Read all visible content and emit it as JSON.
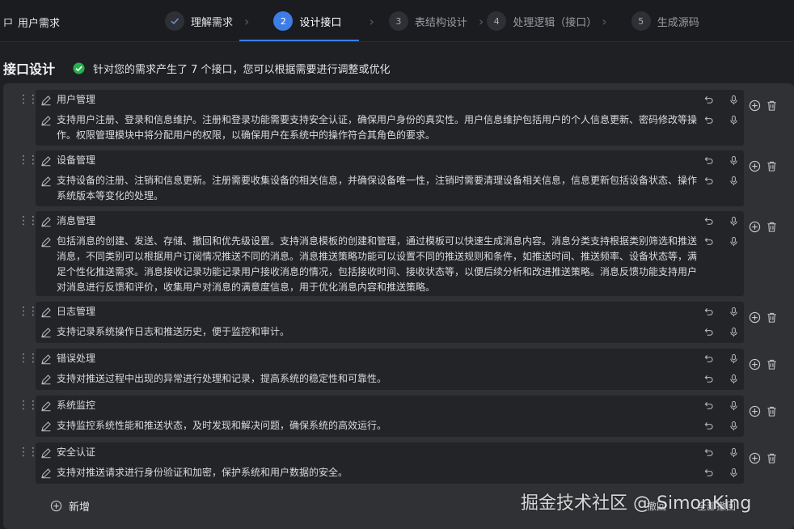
{
  "crumb": {
    "label": "用户需求"
  },
  "steps": [
    {
      "num": "✓",
      "label": "理解需求"
    },
    {
      "num": "2",
      "label": "设计接口"
    },
    {
      "num": "3",
      "label": "表结构设计"
    },
    {
      "num": "4",
      "label": "处理逻辑（接口）"
    },
    {
      "num": "5",
      "label": "生成源码"
    }
  ],
  "header": {
    "title": "接口设计",
    "message": "针对您的需求产生了 7 个接口，您可以根据需要进行调整或优化"
  },
  "interfaces": [
    {
      "name": "用户管理",
      "desc": "支持用户注册、登录和信息维护。注册和登录功能需要支持安全认证，确保用户身份的真实性。用户信息维护包括用户的个人信息更新、密码修改等操作。权限管理模块中将分配用户的权限，以确保用户在系统中的操作符合其角色的要求。"
    },
    {
      "name": "设备管理",
      "desc": "支持设备的注册、注销和信息更新。注册需要收集设备的相关信息，并确保设备唯一性，注销时需要清理设备相关信息，信息更新包括设备状态、操作系统版本等变化的处理。"
    },
    {
      "name": "消息管理",
      "desc": "包括消息的创建、发送、存储、撤回和优先级设置。支持消息模板的创建和管理，通过模板可以快速生成消息内容。消息分类支持根据类别筛选和推送消息，不同类别可以根据用户订阅情况推送不同的消息。消息推送策略功能可以设置不同的推送规则和条件，如推送时间、推送频率、设备状态等，满足个性化推送需求。消息接收记录功能记录用户接收消息的情况，包括接收时间、接收状态等，以便后续分析和改进推送策略。消息反馈功能支持用户对消息进行反馈和评价，收集用户对消息的满意度信息，用于优化消息内容和推送策略。"
    },
    {
      "name": "日志管理",
      "desc": "支持记录系统操作日志和推送历史，便于监控和审计。"
    },
    {
      "name": "错误处理",
      "desc": "支持对推送过程中出现的异常进行处理和记录，提高系统的稳定性和可靠性。"
    },
    {
      "name": "系统监控",
      "desc": "支持监控系统性能和推送状态，及时发现和解决问题，确保系统的高效运行。"
    },
    {
      "name": "安全认证",
      "desc": "支持对推送请求进行身份验证和加密，保护系统和用户数据的安全。"
    }
  ],
  "footer": {
    "add_label": "新增",
    "btn1": "撤回",
    "btn2": "全部撤回"
  },
  "watermark": "掘金技术社区 @ SimonKing",
  "colors": {
    "accent": "#3d7de6",
    "success": "#22b14c",
    "panel": "#303135",
    "card": "#232428"
  }
}
